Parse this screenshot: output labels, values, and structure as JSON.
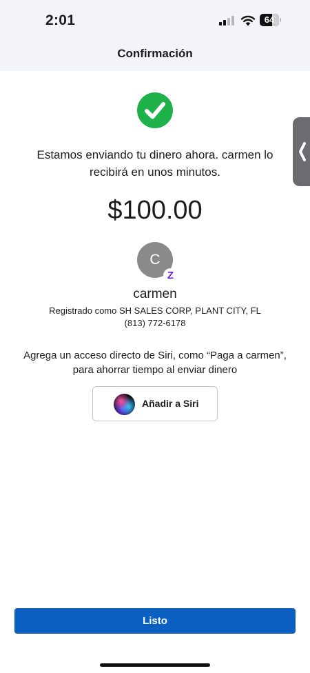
{
  "status_bar": {
    "time": "2:01",
    "battery": "64",
    "battery_level": 0.64,
    "signal_icon": "cellular-signal-icon",
    "wifi_icon": "wifi-icon"
  },
  "nav": {
    "title": "Confirmación"
  },
  "confirmation": {
    "status_icon": "checkmark-circle-icon",
    "status_color": "#1fb24a",
    "message": "Estamos enviando tu dinero ahora. carmen  lo recibirá en unos minutos.",
    "amount": "$100.00"
  },
  "recipient": {
    "initial": "C",
    "badge_icon": "zelle-icon",
    "badge_text": "Z",
    "badge_color": "#6d1ed4",
    "name": "carmen",
    "registered": "Registrado como SH SALES CORP, PLANT CITY, FL",
    "phone": "(813) 772-6178"
  },
  "siri": {
    "prompt": "Agrega un acceso directo de Siri, como “Paga a carmen”, para ahorrar tiempo al enviar dinero",
    "button_label": "Añadir a Siri",
    "icon": "siri-icon"
  },
  "side_handle": {
    "icon": "chevron-left-icon"
  },
  "footer": {
    "done_label": "Listo",
    "accent_color": "#0b5fc1"
  }
}
